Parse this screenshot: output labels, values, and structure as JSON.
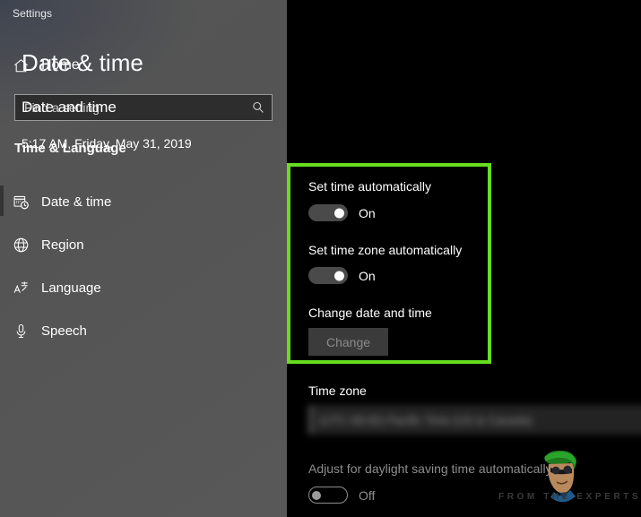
{
  "window": {
    "title": "Settings"
  },
  "sidebar": {
    "home": {
      "label": "Home",
      "icon": "home-icon"
    },
    "search": {
      "placeholder": "Find a setting",
      "value": "",
      "icon": "search-icon"
    },
    "section_heading": "Time & Language",
    "items": [
      {
        "label": "Date & time",
        "icon": "calendar-clock-icon",
        "selected": true
      },
      {
        "label": "Region",
        "icon": "globe-icon",
        "selected": false
      },
      {
        "label": "Language",
        "icon": "language-icon",
        "selected": false
      },
      {
        "label": "Speech",
        "icon": "microphone-icon",
        "selected": false
      }
    ]
  },
  "main": {
    "page_title": "Date & time",
    "sub_title": "Date and time",
    "current_datetime": "5:17 AM, Friday, May 31, 2019",
    "settings": {
      "set_time_auto": {
        "label": "Set time automatically",
        "state": "On"
      },
      "set_timezone_auto": {
        "label": "Set time zone automatically",
        "state": "On"
      },
      "change_datetime": {
        "label": "Change date and time",
        "button_label": "Change"
      },
      "time_zone": {
        "label": "Time zone",
        "value": "(UTC-08:00) Pacific Time (US & Canada)"
      },
      "daylight_saving": {
        "label": "Adjust for daylight saving time automatically",
        "state": "Off"
      }
    }
  },
  "watermark": {
    "tagline": "FROM THE EXPERTS!"
  },
  "colors": {
    "highlight_green": "#66dd1e",
    "sidebar_gray": "#565656",
    "main_black": "#000000",
    "accent_text": "#ffffff"
  }
}
